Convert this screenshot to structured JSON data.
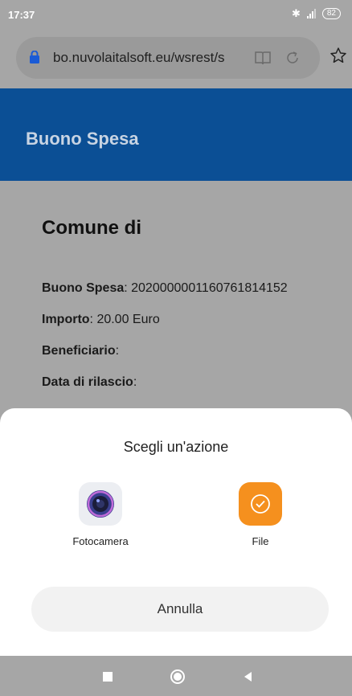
{
  "status_bar": {
    "time": "17:37",
    "battery": "82"
  },
  "browser": {
    "url": "bo.nuvolaitalsoft.eu/wsrest/s"
  },
  "header": {
    "title": "Buono Spesa"
  },
  "voucher": {
    "heading": "Comune di",
    "buono_label": "Buono Spesa",
    "buono_value": ": 20200000011607618141​52",
    "importo_label": "Importo",
    "importo_value": ": 20.00 Euro",
    "beneficiario_label": "Beneficiario",
    "beneficiario_value": ":",
    "data_label": "Data di rilascio",
    "data_value": ":"
  },
  "sheet": {
    "title": "Scegli un'azione",
    "options": [
      {
        "label": "Fotocamera",
        "icon": "camera-icon"
      },
      {
        "label": "File",
        "icon": "file-check-icon"
      }
    ],
    "cancel_label": "Annulla"
  },
  "colors": {
    "header_bg": "#0b4f95",
    "file_icon_bg": "#f5901e"
  }
}
